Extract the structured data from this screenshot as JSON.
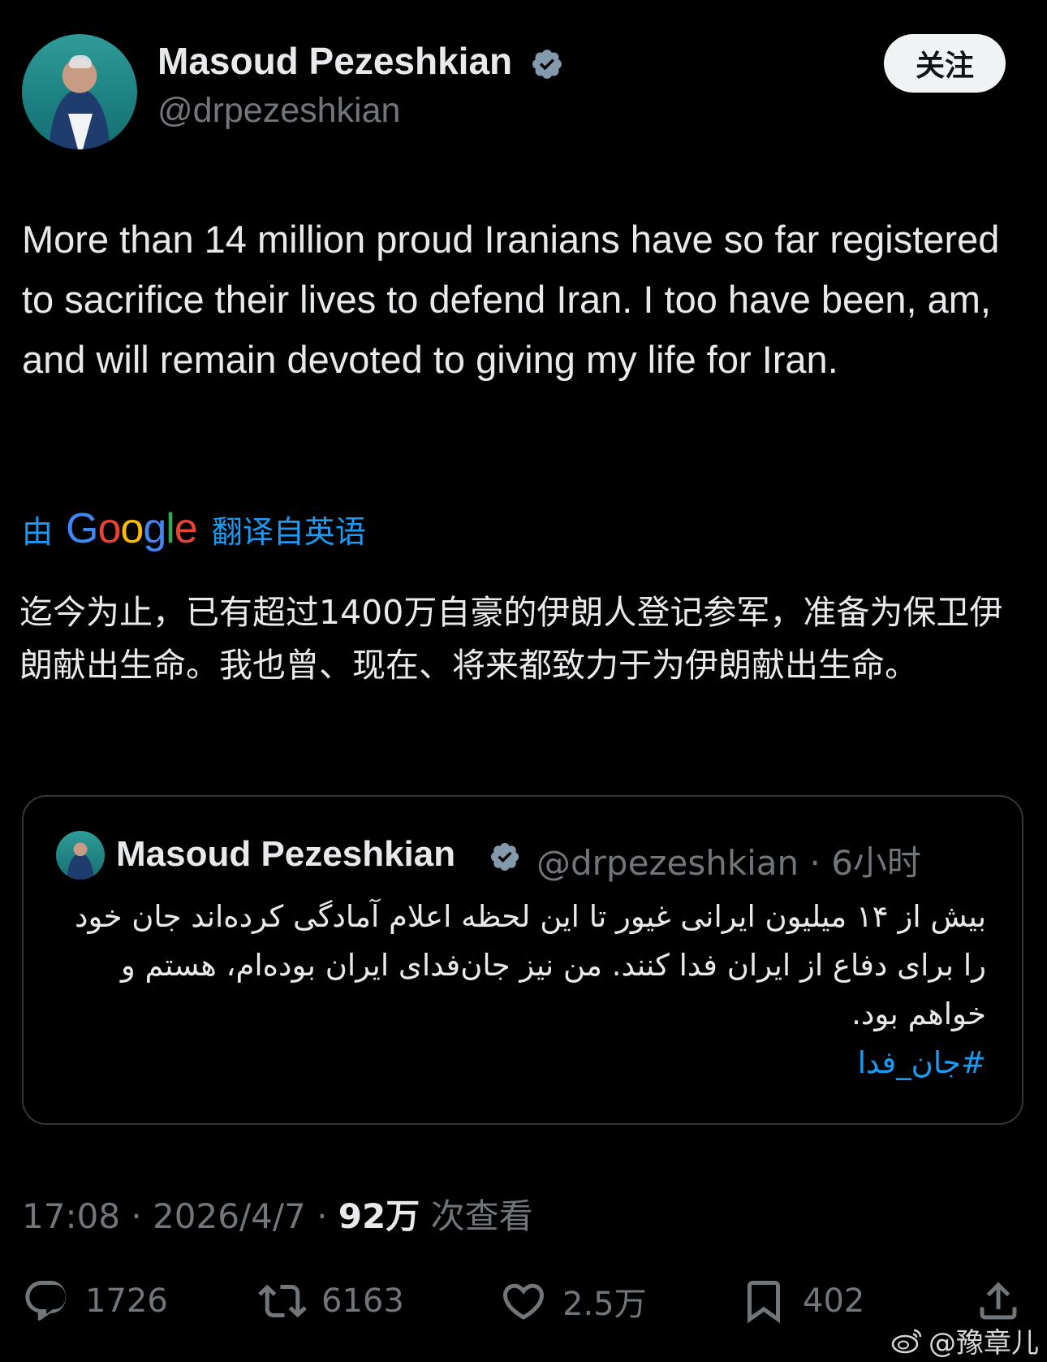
{
  "author": {
    "name": "Masoud Pezeshkian",
    "handle": "@drpezeshkian",
    "verified_color": "#829aab"
  },
  "follow_button": {
    "label": "关注"
  },
  "tweet": {
    "text": "More than 14 million proud Iranians have so far registered to sacrifice their lives to defend Iran. I too have been, am, and will remain devoted to giving my life for Iran."
  },
  "translation": {
    "prefix": "由",
    "google_letters": [
      {
        "ch": "G",
        "color": "#4285f4"
      },
      {
        "ch": "o",
        "color": "#ea4335"
      },
      {
        "ch": "o",
        "color": "#fbbc05"
      },
      {
        "ch": "g",
        "color": "#4285f4"
      },
      {
        "ch": "l",
        "color": "#34a853"
      },
      {
        "ch": "e",
        "color": "#ea4335"
      }
    ],
    "suffix": "翻译自英语",
    "text": "迄今为止，已有超过1400万自豪的伊朗人登记参军，准备为保卫伊朗献出生命。我也曾、现在、将来都致力于为伊朗献出生命。"
  },
  "quoted_tweet": {
    "name": "Masoud Pezeshkian",
    "handle_time": "@drpezeshkian · 6小时",
    "text": "بیش از ۱۴ میلیون ایرانی غیور تا این لحظه اعلام آمادگی کرده‌اند جان خود را برای دفاع از ایران فدا کنند. من نیز جان‌فدای ایران بوده‌ام، هستم و خواهم بود.",
    "hashtag": "#جان_فدا"
  },
  "meta": {
    "time_date": "17:08 · 2026/4/7 · ",
    "views_count": "92万",
    "views_label": " 次查看"
  },
  "actions": {
    "replies": "1726",
    "retweets": "6163",
    "likes": "2.5万",
    "bookmarks": "402"
  },
  "watermark": {
    "text": "@豫章儿"
  },
  "colors": {
    "accent": "#1d9bf0",
    "muted": "#71767b",
    "text": "#e7e9ea",
    "background": "#000000"
  }
}
